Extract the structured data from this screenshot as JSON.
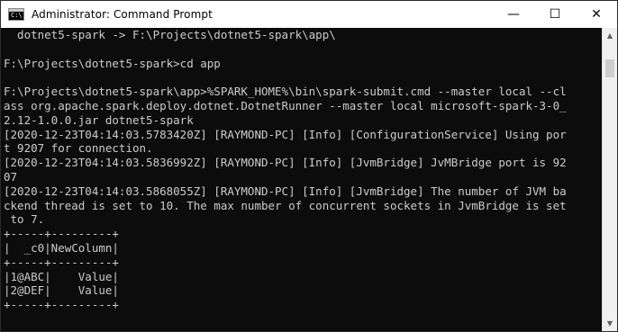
{
  "window": {
    "title": "Administrator: Command Prompt",
    "icon": "cmd-icon",
    "controls": {
      "minimize": "—",
      "maximize": "☐",
      "close": "✕"
    }
  },
  "console": {
    "lines": [
      "  dotnet5-spark -> F:\\Projects\\dotnet5-spark\\app\\",
      "",
      "F:\\Projects\\dotnet5-spark>cd app",
      "",
      "F:\\Projects\\dotnet5-spark\\app>%SPARK_HOME%\\bin\\spark-submit.cmd --master local --cl",
      "ass org.apache.spark.deploy.dotnet.DotnetRunner --master local microsoft-spark-3-0_",
      "2.12-1.0.0.jar dotnet5-spark",
      "[2020-12-23T04:14:03.5783420Z] [RAYMOND-PC] [Info] [ConfigurationService] Using por",
      "t 9207 for connection.",
      "[2020-12-23T04:14:03.5836992Z] [RAYMOND-PC] [Info] [JvmBridge] JvMBridge port is 92",
      "07",
      "[2020-12-23T04:14:03.5868055Z] [RAYMOND-PC] [Info] [JvmBridge] The number of JVM ba",
      "ckend thread is set to 10. The max number of concurrent sockets in JvmBridge is set",
      " to 7.",
      "+-----+---------+",
      "|  _c0|NewColumn|",
      "+-----+---------+",
      "|1@ABC|    Value|",
      "|2@DEF|    Value|",
      "+-----+---------+",
      ""
    ]
  },
  "scrollbar": {
    "up_icon": "▲",
    "down_icon": "▼"
  }
}
